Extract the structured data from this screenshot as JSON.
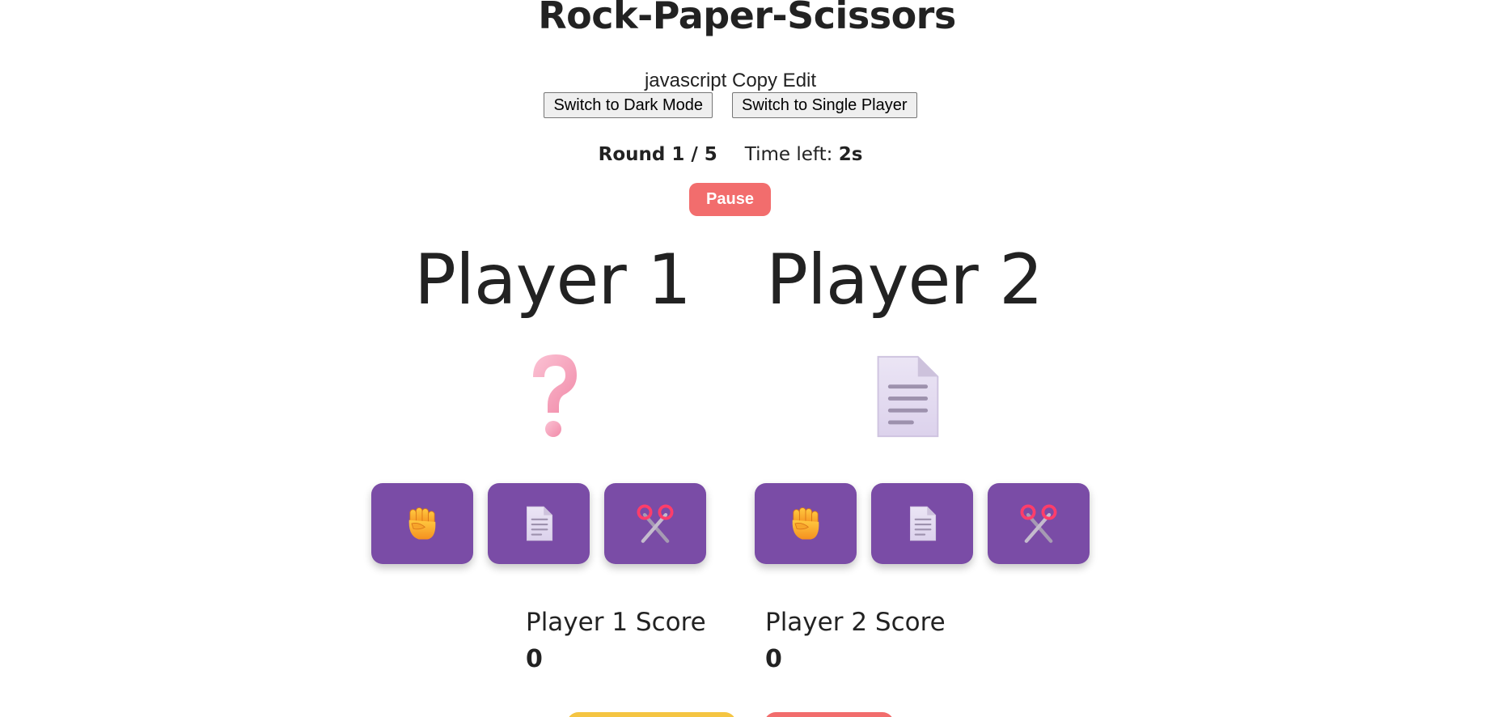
{
  "page": {
    "title": "Rock-Paper-Scissors",
    "code_label": "javascript Copy Edit"
  },
  "controls": {
    "dark_mode_label": "Switch to Dark Mode",
    "single_player_label": "Switch to Single Player",
    "pause_label": "Pause"
  },
  "status": {
    "round_text": "Round 1 / 5",
    "time_label": "Time left: ",
    "time_value": "2s"
  },
  "players": [
    {
      "name": "Player 1",
      "current_choice": "question-mark",
      "choices": [
        "rock-fist-icon",
        "paper-document-icon",
        "scissors-icon"
      ],
      "score_label": "Player 1 Score",
      "score": "0"
    },
    {
      "name": "Player 2",
      "current_choice": "paper",
      "choices": [
        "rock-fist-icon",
        "paper-document-icon",
        "scissors-icon"
      ],
      "score_label": "Player 2 Score",
      "score": "0"
    }
  ],
  "colors": {
    "choice_button_bg": "#7a4ca6",
    "pause_button_bg": "#f26d6d",
    "bottom_left_button_bg": "#f5c542",
    "bottom_right_button_bg": "#f26d6d"
  }
}
